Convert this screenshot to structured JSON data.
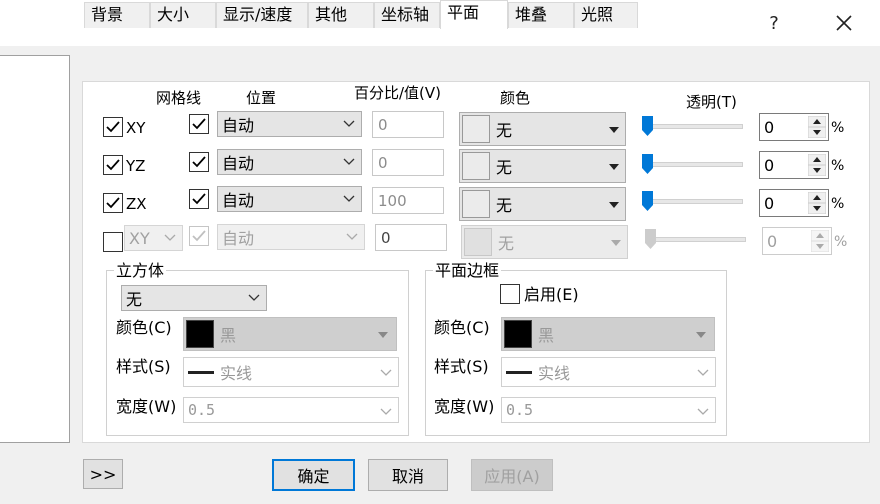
{
  "titlebar": {
    "help_label": "?",
    "close_label": "✕"
  },
  "tabs": [
    "背景",
    "大小",
    "显示/速度",
    "其他",
    "坐标轴",
    "平面",
    "堆叠",
    "光照"
  ],
  "headers": {
    "grid": "网格线",
    "position": "位置",
    "percent": "百分比/值(V)",
    "color": "颜色",
    "transparency": "透明(T)"
  },
  "rows": [
    {
      "plane": "XY",
      "checked": true,
      "grid_checked": true,
      "position": "自动",
      "percent": "0",
      "color_name": "无",
      "transparency": "0",
      "unit": "%"
    },
    {
      "plane": "YZ",
      "checked": true,
      "grid_checked": true,
      "position": "自动",
      "percent": "0",
      "color_name": "无",
      "transparency": "0",
      "unit": "%"
    },
    {
      "plane": "ZX",
      "checked": true,
      "grid_checked": true,
      "position": "自动",
      "percent": "100",
      "color_name": "无",
      "transparency": "0",
      "unit": "%"
    },
    {
      "plane": "XY",
      "checked": false,
      "grid_checked": true,
      "position": "自动",
      "percent": "0",
      "color_name": "无",
      "transparency": "0",
      "unit": "%"
    }
  ],
  "cube": {
    "title": "立方体",
    "type_value": "无",
    "color_label": "颜色(C)",
    "color_value": "黑",
    "style_label": "样式(S)",
    "style_value": "实线",
    "width_label": "宽度(W)",
    "width_value": "0.5"
  },
  "plane_border": {
    "title": "平面边框",
    "enable_label": "启用(E)",
    "color_label": "颜色(C)",
    "color_value": "黑",
    "style_label": "样式(S)",
    "style_value": "实线",
    "width_label": "宽度(W)",
    "width_value": "0.5"
  },
  "footer": {
    "expand_label": ">>",
    "ok_label": "确定",
    "cancel_label": "取消",
    "apply_label": "应用(A)"
  },
  "colors": {
    "accent": "#0078d7",
    "black": "#000000"
  }
}
